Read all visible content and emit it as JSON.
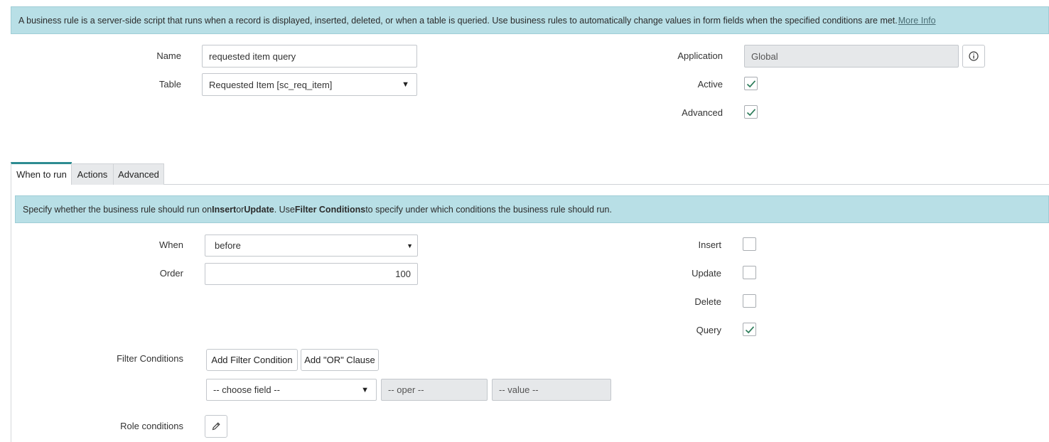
{
  "top_info": {
    "text": "A business rule is a server-side script that runs when a record is displayed, inserted, deleted, or when a table is queried. Use business rules to automatically change values in form fields when the specified conditions are met.",
    "link": "More Info"
  },
  "form": {
    "name_label": "Name",
    "name_value": "requested item query",
    "table_label": "Table",
    "table_value": "Requested Item [sc_req_item]",
    "application_label": "Application",
    "application_value": "Global",
    "active_label": "Active",
    "active_checked": true,
    "advanced_label": "Advanced",
    "advanced_checked": true
  },
  "tabs": [
    {
      "label": "When to run",
      "active": true
    },
    {
      "label": "Actions",
      "active": false
    },
    {
      "label": "Advanced",
      "active": false
    }
  ],
  "tab_info": {
    "t1": "Specify whether the business rule should run on",
    "b1": "Insert",
    "t2": "or",
    "b2": "Update",
    "t3": ". Use",
    "b3": "Filter Conditions",
    "t4": "to specify under which conditions the business rule should run."
  },
  "when_to_run": {
    "when_label": "When",
    "when_value": "before",
    "order_label": "Order",
    "order_value": "100",
    "insert_label": "Insert",
    "insert_checked": false,
    "update_label": "Update",
    "update_checked": false,
    "delete_label": "Delete",
    "delete_checked": false,
    "query_label": "Query",
    "query_checked": true,
    "filter_label": "Filter Conditions",
    "add_filter_label": "Add Filter Condition",
    "add_or_label": "Add \"OR\" Clause",
    "choose_field": "-- choose field --",
    "oper": "-- oper --",
    "value": "-- value --",
    "role_label": "Role conditions"
  },
  "colors": {
    "info_bg": "#b8dfe6",
    "accent": "#2d8c91",
    "check": "#2e7d5b"
  }
}
